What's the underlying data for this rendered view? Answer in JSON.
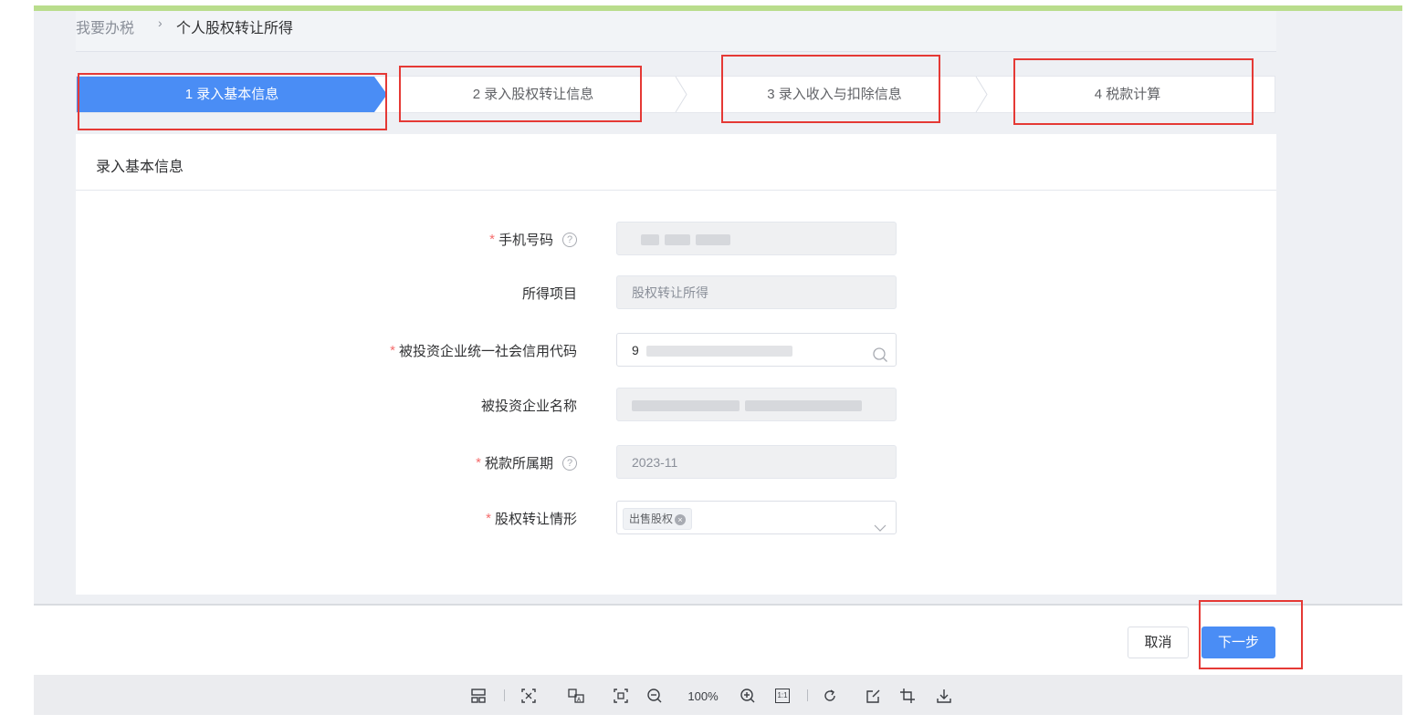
{
  "breadcrumb": {
    "root": "我要办税",
    "separator": "›",
    "current": "个人股权转让所得"
  },
  "steps": [
    {
      "label": "1  录入基本信息",
      "active": true
    },
    {
      "label": "2  录入股权转让信息",
      "active": false
    },
    {
      "label": "3  录入收入与扣除信息",
      "active": false
    },
    {
      "label": "4  税款计算",
      "active": false
    }
  ],
  "card": {
    "title": "录入基本信息"
  },
  "form": {
    "phone": {
      "label": "手机号码",
      "required": "*",
      "help": "?"
    },
    "income_item": {
      "label": "所得项目",
      "value": "股权转让所得"
    },
    "credit_code": {
      "label": "被投资企业统一社会信用代码",
      "required": "*",
      "value_prefix": "9"
    },
    "company_name": {
      "label": "被投资企业名称"
    },
    "tax_period": {
      "label": "税款所属期",
      "required": "*",
      "help": "?",
      "value": "2023-11"
    },
    "transfer_type": {
      "label": "股权转让情形",
      "required": "*",
      "tag": "出售股权",
      "tag_close": "×"
    }
  },
  "footer": {
    "cancel_label": "取消",
    "next_label": "下一步"
  },
  "toolbar": {
    "zoom_level": "100%",
    "ratio_label": "1:1"
  },
  "colors": {
    "primary": "#4a8df5",
    "required": "#f56c6c",
    "highlight": "#e53935",
    "top_accent": "#b9dd8c"
  }
}
